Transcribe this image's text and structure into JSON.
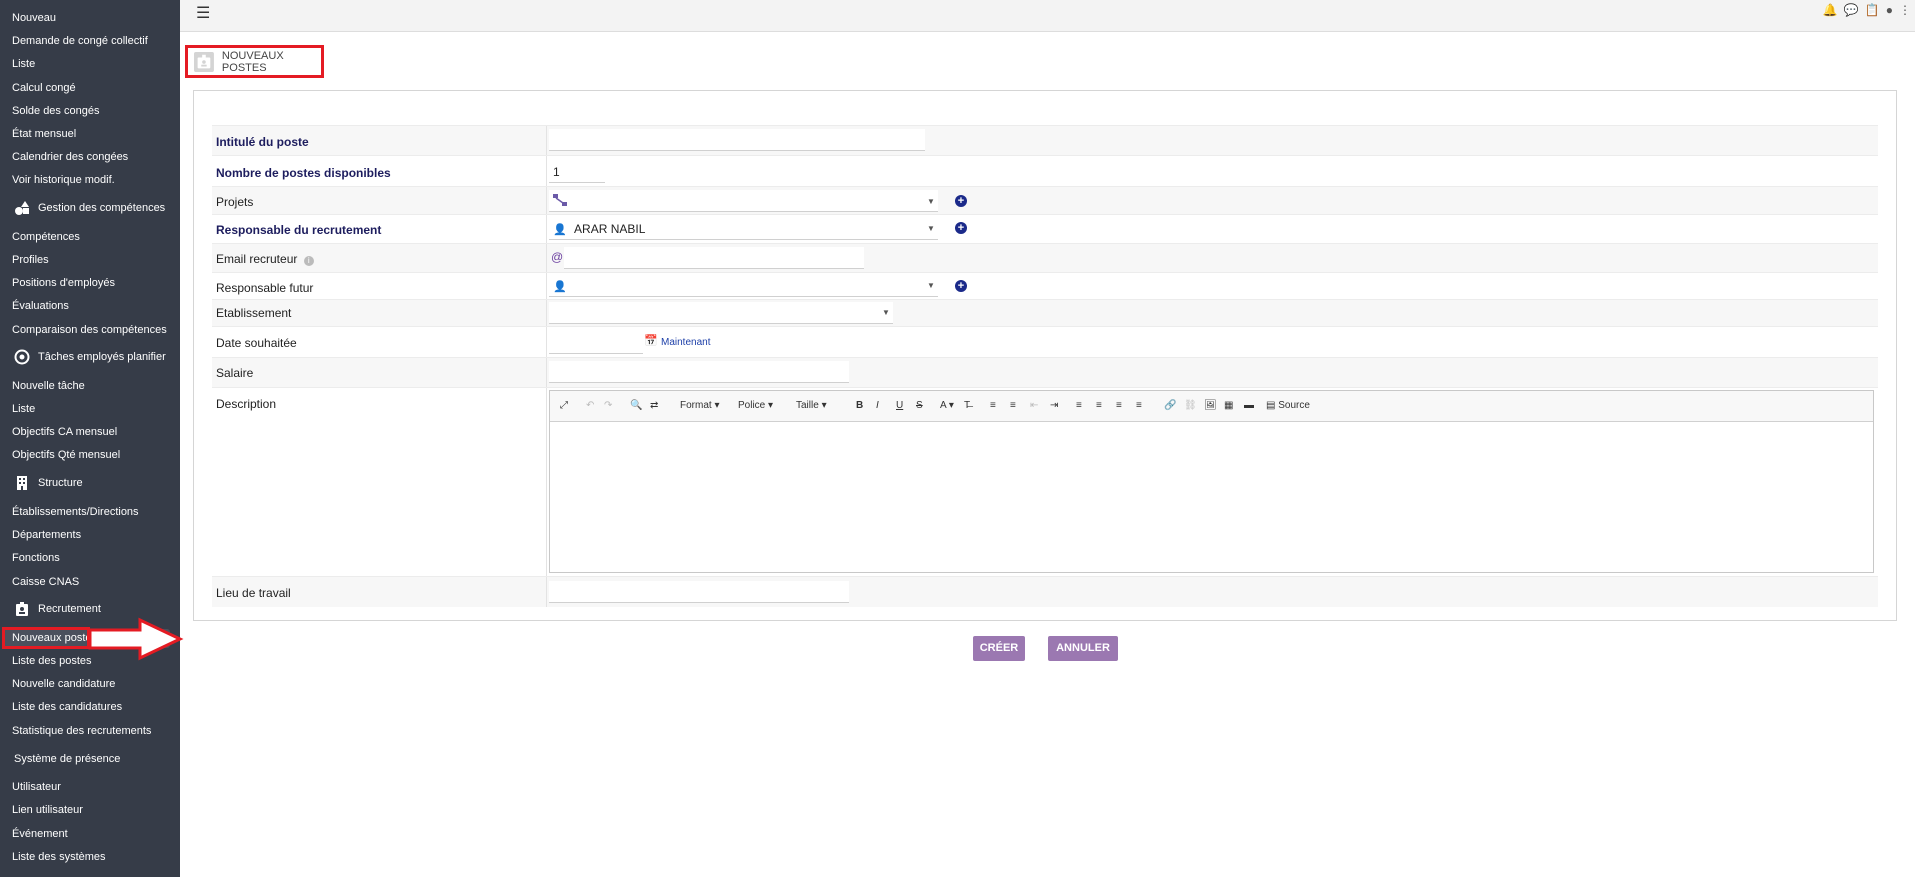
{
  "sidebar": {
    "items": [
      {
        "label": "Nouveau"
      },
      {
        "label": "Demande de congé collectif"
      },
      {
        "label": "Liste"
      },
      {
        "label": "Calcul congé"
      },
      {
        "label": "Solde des congés"
      },
      {
        "label": "État mensuel"
      },
      {
        "label": "Calendrier des congées"
      },
      {
        "label": "Voir historique modif."
      },
      {
        "label": "Gestion des compétences",
        "icon": "shapes-icon"
      },
      {
        "label": "Compétences"
      },
      {
        "label": "Profiles"
      },
      {
        "label": "Positions d'employés"
      },
      {
        "label": "Évaluations"
      },
      {
        "label": "Comparaison des compétences"
      },
      {
        "label": "Tâches employés planifier",
        "icon": "target-icon"
      },
      {
        "label": "Nouvelle tâche"
      },
      {
        "label": "Liste"
      },
      {
        "label": "Objectifs CA mensuel"
      },
      {
        "label": "Objectifs Qté mensuel"
      },
      {
        "label": "Structure",
        "icon": "building-icon"
      },
      {
        "label": "Établissements/Directions"
      },
      {
        "label": "Départements"
      },
      {
        "label": "Fonctions"
      },
      {
        "label": "Caisse CNAS"
      },
      {
        "label": "Recrutement",
        "icon": "id-badge-icon"
      },
      {
        "label": "Nouveaux postes",
        "active": true
      },
      {
        "label": "Liste des postes"
      },
      {
        "label": "Nouvelle candidature"
      },
      {
        "label": "Liste des candidatures"
      },
      {
        "label": "Statistique des recrutements"
      },
      {
        "label": "Système de présence"
      },
      {
        "label": "Utilisateur"
      },
      {
        "label": "Lien utilisateur"
      },
      {
        "label": "Événement"
      },
      {
        "label": "Liste des systèmes"
      }
    ]
  },
  "page": {
    "title": "NOUVEAUX POSTES"
  },
  "form": {
    "intitule_label": "Intitulé du poste",
    "nombre_label": "Nombre de postes disponibles",
    "nombre_value": "1",
    "projets_label": "Projets",
    "responsable_label": "Responsable du recrutement",
    "responsable_value": "ARAR NABIL",
    "email_label": "Email recruteur",
    "email_prefix": "@",
    "responsable_futur_label": "Responsable futur",
    "etablissement_label": "Etablissement",
    "date_label": "Date souhaitée",
    "maintenant_label": "Maintenant",
    "salaire_label": "Salaire",
    "description_label": "Description",
    "lieu_label": "Lieu de travail"
  },
  "editor": {
    "format": "Format",
    "police": "Police",
    "taille": "Taille",
    "source": "Source"
  },
  "actions": {
    "create": "CRÉER",
    "cancel": "ANNULER"
  },
  "colors": {
    "sidebar": "#363c48",
    "button": "#9b78b1",
    "highlight": "#e41b23",
    "required_label": "#1d1d5e"
  }
}
